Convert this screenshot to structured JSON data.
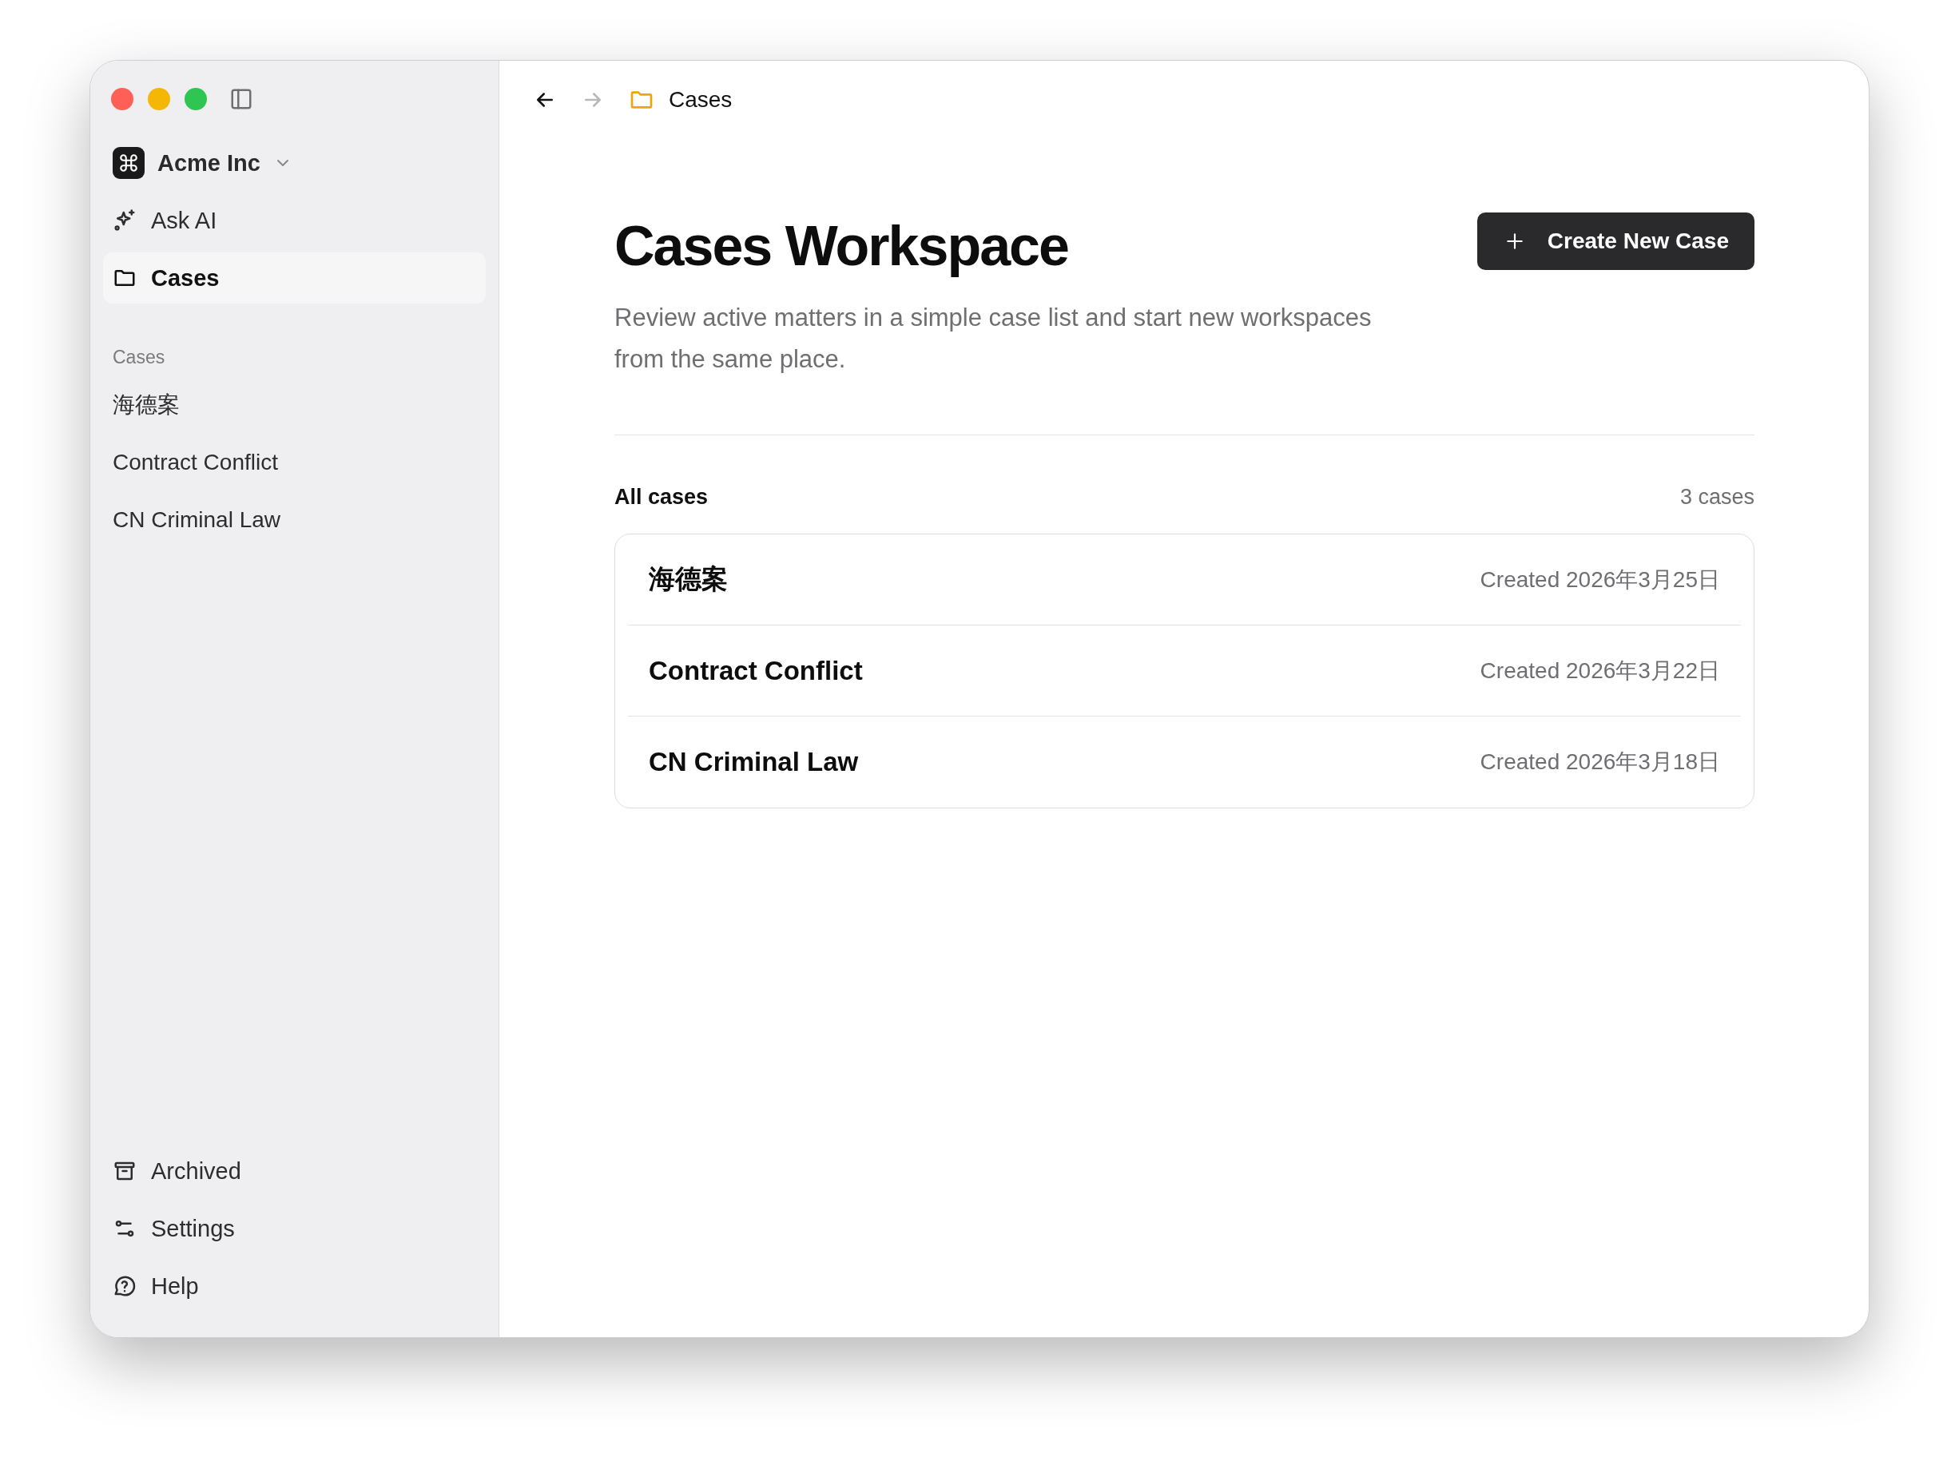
{
  "sidebar": {
    "workspace": {
      "name": "Acme Inc"
    },
    "nav": [
      {
        "label": "Ask AI",
        "kind": "sparkle",
        "selected": false
      },
      {
        "label": "Cases",
        "kind": "folder",
        "selected": true
      }
    ],
    "section_title": "Cases",
    "cases": [
      {
        "label": "海德案",
        "selected": false
      },
      {
        "label": "Contract Conflict",
        "selected": false
      },
      {
        "label": "CN Criminal Law",
        "selected": false
      }
    ],
    "footer": [
      {
        "label": "Archived",
        "kind": "archive"
      },
      {
        "label": "Settings",
        "kind": "sliders"
      },
      {
        "label": "Help",
        "kind": "help"
      }
    ]
  },
  "toolbar": {
    "back": {
      "disabled": false
    },
    "forward": {
      "disabled": true
    },
    "breadcrumb": "Cases"
  },
  "header": {
    "title": "Cases Workspace",
    "description": "Review active matters in a simple case list and start new workspaces from the same place.",
    "button": "Create New Case"
  },
  "list": {
    "title": "All cases",
    "count": "3 cases",
    "rows": [
      {
        "name": "海德案",
        "created": "Created 2026年3月25日"
      },
      {
        "name": "Contract Conflict",
        "created": "Created 2026年3月22日"
      },
      {
        "name": "CN Criminal Law",
        "created": "Created 2026年3月18日"
      }
    ]
  }
}
